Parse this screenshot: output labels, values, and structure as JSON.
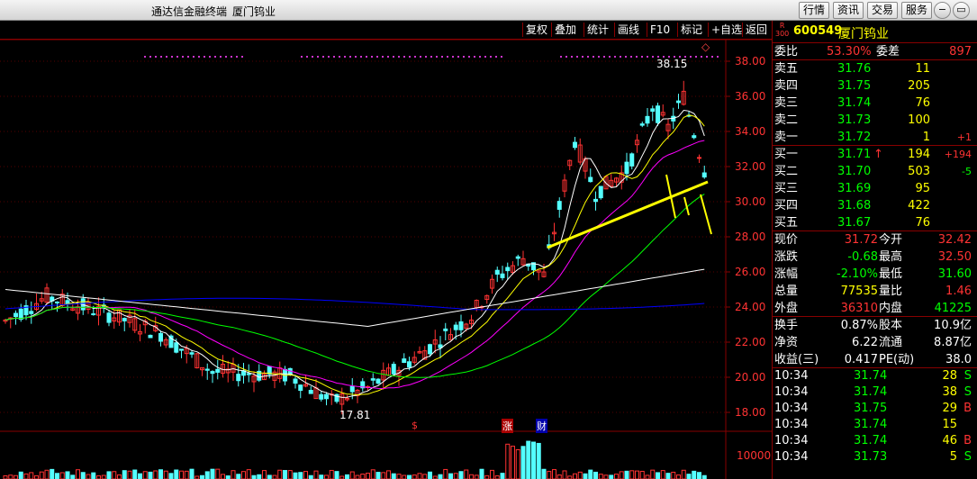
{
  "app": {
    "title": "通达信金融终端",
    "stock_title": "厦门钨业"
  },
  "top_buttons": [
    "行情",
    "资讯",
    "交易",
    "服务"
  ],
  "window_controls": {
    "minimize": "−",
    "restore": "▭",
    "close": "×"
  },
  "toolbar": [
    "复权",
    "叠加",
    "统计",
    "画线",
    "F10",
    "标记",
    "+自选",
    "返回"
  ],
  "chart": {
    "price_ticks": [
      "38.00",
      "36.00",
      "34.00",
      "32.00",
      "30.00",
      "28.00",
      "26.00",
      "24.00",
      "22.00",
      "20.00",
      "18.00"
    ],
    "volume_ticks": [
      "10000"
    ],
    "high_label": "38.15",
    "low_label": "17.81",
    "markers": [
      "$",
      "涨",
      "财"
    ],
    "diamond": "◇",
    "colors": {
      "up": "#ff3232",
      "down": "#54ffff",
      "ma5": "#ffffff",
      "ma10": "#ffff00",
      "ma20": "#ff00ff",
      "ma60": "#00ff00",
      "ma120": "#0000ff",
      "ma250": "#ffffff",
      "trend": "#ffff00"
    }
  },
  "quote": {
    "rs_label": "R\n300",
    "code": "600549",
    "name": "厦门钨业",
    "weibi_label": "委比",
    "weibi": "53.30%",
    "weicha_label": "委差",
    "weicha": "897",
    "asks": [
      {
        "label": "卖五",
        "price": "31.76",
        "vol": "11",
        "chg": ""
      },
      {
        "label": "卖四",
        "price": "31.75",
        "vol": "205",
        "chg": ""
      },
      {
        "label": "卖三",
        "price": "31.74",
        "vol": "76",
        "chg": ""
      },
      {
        "label": "卖二",
        "price": "31.73",
        "vol": "100",
        "chg": ""
      },
      {
        "label": "卖一",
        "price": "31.72",
        "vol": "1",
        "chg": "+1"
      }
    ],
    "bids": [
      {
        "label": "买一",
        "price": "31.71",
        "arrow": "↑",
        "vol": "194",
        "chg": "+194"
      },
      {
        "label": "买二",
        "price": "31.70",
        "arrow": "",
        "vol": "503",
        "chg": "-5"
      },
      {
        "label": "买三",
        "price": "31.69",
        "arrow": "",
        "vol": "95",
        "chg": ""
      },
      {
        "label": "买四",
        "price": "31.68",
        "arrow": "",
        "vol": "422",
        "chg": ""
      },
      {
        "label": "买五",
        "price": "31.67",
        "arrow": "",
        "vol": "76",
        "chg": ""
      }
    ],
    "stats": [
      {
        "l1": "现价",
        "v1": "31.72",
        "l2": "今开",
        "v2": "32.42"
      },
      {
        "l1": "涨跌",
        "v1": "-0.68",
        "l2": "最高",
        "v2": "32.50"
      },
      {
        "l1": "涨幅",
        "v1": "-2.10%",
        "l2": "最低",
        "v2": "31.60"
      },
      {
        "l1": "总量",
        "v1": "77535",
        "l2": "量比",
        "v2": "1.46"
      },
      {
        "l1": "外盘",
        "v1": "36310",
        "l2": "内盘",
        "v2": "41225"
      }
    ],
    "stats2": [
      {
        "l1": "换手",
        "v1": "0.87%",
        "l2": "股本",
        "v2": "10.9亿"
      },
      {
        "l1": "净资",
        "v1": "6.22",
        "l2": "流通",
        "v2": "8.87亿"
      },
      {
        "l1": "收益(三)",
        "v1": "0.417",
        "l2": "PE(动)",
        "v2": "38.0"
      }
    ],
    "ticks": [
      {
        "time": "10:34",
        "price": "31.74",
        "vol": "28",
        "bs": "S"
      },
      {
        "time": "10:34",
        "price": "31.74",
        "vol": "38",
        "bs": "S"
      },
      {
        "time": "10:34",
        "price": "31.75",
        "vol": "29",
        "bs": "B"
      },
      {
        "time": "10:34",
        "price": "31.74",
        "vol": "15",
        "bs": ""
      },
      {
        "time": "10:34",
        "price": "31.74",
        "vol": "46",
        "bs": "B"
      },
      {
        "time": "10:34",
        "price": "31.73",
        "vol": "5",
        "bs": "S"
      }
    ]
  }
}
